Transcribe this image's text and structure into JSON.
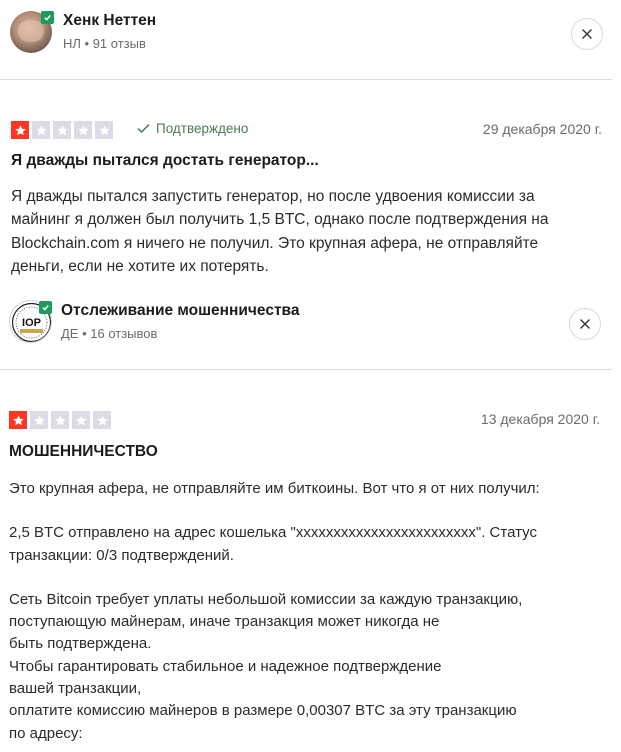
{
  "reviewer1": {
    "name": "Хенк Неттен",
    "meta": "НЛ • 91 отзыв"
  },
  "review1": {
    "rating": 1,
    "status": "Подтверждено",
    "date": "29 декабря 2020 г.",
    "title": "Я дважды пытался достать генератор...",
    "lines": [
      "Я дважды пытался запустить генератор, но после удвоения комиссии за",
      "майнинг я должен был получить 1,5 BTC, однако после подтверждения на",
      "Blockchain.com я ничего не получил. Это крупная афера, не отправляйте",
      "деньги, если не хотите их потерять."
    ]
  },
  "reviewer2": {
    "name": "Отслеживание мошенничества",
    "meta": "ДЕ • 16 отзывов",
    "logo_text": "IOP"
  },
  "review2": {
    "rating": 1,
    "date": "13 декабря 2020 г.",
    "title": "МОШЕННИЧЕСТВО",
    "para1": "Это крупная афера, не отправляйте им биткоины. Вот что я от них получил:",
    "para2": [
      "2,5 BTC отправлено на адрес кошелька \"xxxxxxxxxxxxxxxxxxxxxxxx\". Статус",
      "транзакции: 0/3 подтверждений."
    ],
    "para3": [
      "Сеть Bitcoin требует уплаты небольшой комиссии за каждую транзакцию,",
      "поступающую майнерам, иначе транзакция может никогда не",
      "быть подтверждена.",
      "Чтобы гарантировать стабильное и надежное подтверждение",
      "вашей транзакции,",
      "оплатите комиссию майнеров в размере 0,00307 BTC за эту транзакцию",
      "по адресу:"
    ]
  },
  "colors": {
    "star_on": "#ff3722",
    "star_off": "#dcdce6",
    "verified": "#1e9a5a"
  },
  "icons": [
    "verified-badge-icon",
    "close-icon",
    "star-icon",
    "checkmark-icon"
  ]
}
